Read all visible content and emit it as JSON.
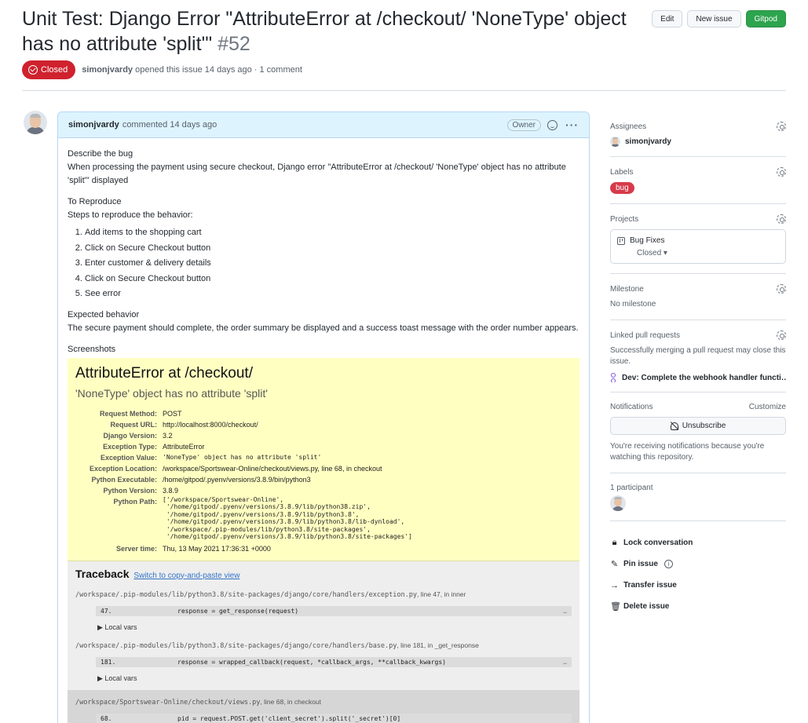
{
  "issue": {
    "title": "Unit Test: Django Error \"AttributeError at /checkout/ 'NoneType' object has no attribute 'split'\"",
    "number": "#52",
    "state": "Closed",
    "author": "simonjvardy",
    "meta_rest": "opened this issue 14 days ago · 1 comment"
  },
  "header_buttons": {
    "edit": "Edit",
    "new_issue": "New issue",
    "gitpod": "Gitpod"
  },
  "comment": {
    "author": "simonjvardy",
    "action": "commented 14 days ago",
    "badge": "Owner",
    "describe_title": "Describe the bug",
    "describe_text": "When processing the payment using secure checkout, Django error \"AttributeError at /checkout/ 'NoneType' object has no attribute 'split'\" displayed",
    "reproduce_title": "To Reproduce",
    "reproduce_intro": "Steps to reproduce the behavior:",
    "steps": [
      "Add items to the shopping cart",
      "Click on Secure Checkout button",
      "Enter customer & delivery details",
      "Click on Secure Checkout button",
      "See error"
    ],
    "expected_title": "Expected behavior",
    "expected_text": "The secure payment should complete, the order summary be displayed and a success toast message with the order number appears.",
    "screenshots_title": "Screenshots"
  },
  "django_error": {
    "heading": "AttributeError at /checkout/",
    "subheading": "'NoneType' object has no attribute 'split'",
    "rows": [
      {
        "key": "Request Method:",
        "value": "POST"
      },
      {
        "key": "Request URL:",
        "value": "http://localhost:8000/checkout/"
      },
      {
        "key": "Django Version:",
        "value": "3.2"
      },
      {
        "key": "Exception Type:",
        "value": "AttributeError"
      },
      {
        "key": "Exception Value:",
        "value": "'NoneType' object has no attribute 'split'"
      },
      {
        "key": "Exception Location:",
        "value": "/workspace/Sportswear-Online/checkout/views.py, line 68, in checkout"
      },
      {
        "key": "Python Executable:",
        "value": "/home/gitpod/.pyenv/versions/3.8.9/bin/python3"
      },
      {
        "key": "Python Version:",
        "value": "3.8.9"
      },
      {
        "key": "Python Path:",
        "value": "['/workspace/Sportswear-Online',\n '/home/gitpod/.pyenv/versions/3.8.9/lib/python38.zip',\n '/home/gitpod/.pyenv/versions/3.8.9/lib/python3.8',\n '/home/gitpod/.pyenv/versions/3.8.9/lib/python3.8/lib-dynload',\n '/workspace/.pip-modules/lib/python3.8/site-packages',\n '/home/gitpod/.pyenv/versions/3.8.9/lib/python3.8/site-packages']"
      },
      {
        "key": "Server time:",
        "value": "Thu, 13 May 2021 17:36:31 +0000"
      }
    ],
    "traceback_title": "Traceback",
    "traceback_link": "Switch to copy-and-paste view",
    "local_vars": "▶ Local vars",
    "frames": [
      {
        "path": "/workspace/.pip-modules/lib/python3.8/site-packages/django/core/handlers/exception.py",
        "where": ", line 47, in inner",
        "line_no": "47.",
        "code": "response = get_response(request)"
      },
      {
        "path": "/workspace/.pip-modules/lib/python3.8/site-packages/django/core/handlers/base.py",
        "where": ", line 181, in _get_response",
        "line_no": "181.",
        "code": "response = wrapped_callback(request, *callback_args, **callback_kwargs)"
      },
      {
        "path": "/workspace/Sportswear-Online/checkout/views.py",
        "where": ", line 68, in checkout",
        "line_no": "68.",
        "code": "pid = request.POST.get('client_secret').split('_secret')[0]"
      }
    ]
  },
  "sidebar": {
    "assignees_title": "Assignees",
    "assignee": "simonjvardy",
    "labels_title": "Labels",
    "label": "bug",
    "label_color": "#d73a4a",
    "projects_title": "Projects",
    "project_name": "Bug Fixes",
    "project_status": "Closed ▾",
    "milestone_title": "Milestone",
    "milestone_value": "No milestone",
    "linked_title": "Linked pull requests",
    "linked_text": "Successfully merging a pull request may close this issue.",
    "linked_pr": "Dev: Complete the webhook handler functi…",
    "notifications_title": "Notifications",
    "customize": "Customize",
    "unsubscribe": "Unsubscribe",
    "notifications_text": "You're receiving notifications because you're watching this repository.",
    "participants_title": "1 participant",
    "actions": {
      "lock": "Lock conversation",
      "pin": "Pin issue",
      "transfer": "Transfer issue",
      "delete": "Delete issue"
    }
  },
  "colors": {
    "closed": "#cf222e",
    "gitpod": "#2da44e",
    "comment_header": "#ddf4ff",
    "django_yellow": "#ffffc2"
  }
}
